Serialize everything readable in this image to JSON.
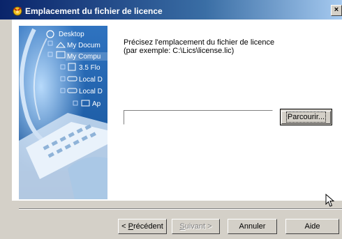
{
  "window": {
    "title": "Emplacement du fichier de licence",
    "close_label": "×"
  },
  "instructions": {
    "line1": "Précisez l'emplacement du fichier de licence",
    "line2": "(par exemple: C:\\Lics\\license.lic)"
  },
  "file_path": {
    "value": "",
    "placeholder": ""
  },
  "browse_button": {
    "label": "Parcourir..."
  },
  "tree": {
    "items": [
      {
        "label": "Desktop",
        "icon": "desktop-icon"
      },
      {
        "label": "My Docum",
        "icon": "folder-icon"
      },
      {
        "label": "My Compu",
        "icon": "computer-icon"
      },
      {
        "label": "3.5 Flo",
        "icon": "floppy-icon"
      },
      {
        "label": "Local D",
        "icon": "drive-icon"
      },
      {
        "label": "Local D",
        "icon": "drive-icon"
      },
      {
        "label": "Ap",
        "icon": "folder-icon"
      }
    ]
  },
  "footer": {
    "back_accel": "P",
    "back_rest": "récédent",
    "back_prefix": "< ",
    "next_accel": "S",
    "next_rest": "uivant",
    "next_suffix": " >",
    "cancel_label": "Annuler",
    "help_label": "Aide"
  },
  "colors": {
    "title_start": "#0a246a",
    "title_end": "#a6caf0",
    "face": "#d4d0c8",
    "panel_blue": "#1f5fa8"
  }
}
